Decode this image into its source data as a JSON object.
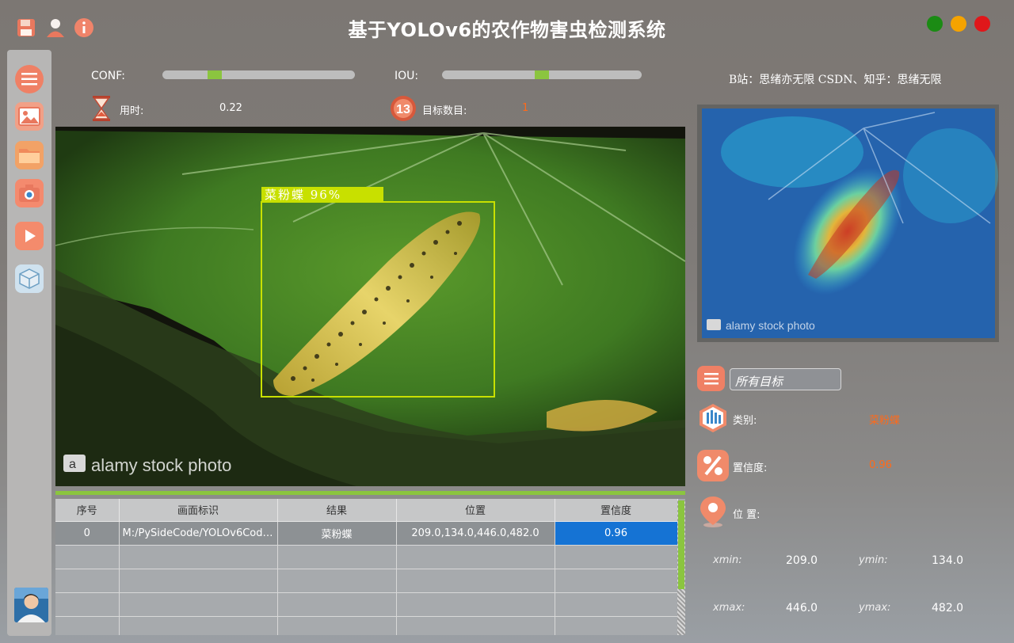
{
  "app": {
    "title": "基于YOLOv6的农作物害虫检测系统",
    "credit": "B站：思绪亦无限  CSDN、知乎：思绪无限",
    "window_buttons": {
      "green": "#1b8b14",
      "yellow": "#f5a300",
      "red": "#e0171a"
    },
    "toolbar_icons": [
      "save-icon",
      "user-icon",
      "info-icon"
    ]
  },
  "sidebar": {
    "items": [
      {
        "icon": "menu-icon"
      },
      {
        "icon": "image-icon"
      },
      {
        "icon": "folder-icon"
      },
      {
        "icon": "camera-icon"
      },
      {
        "icon": "video-icon"
      },
      {
        "icon": "model-cube-icon"
      }
    ]
  },
  "controls": {
    "conf_label": "CONF:",
    "conf_value": 0.3,
    "iou_label": "IOU:",
    "iou_value": 0.5,
    "time_label": "用时:",
    "time_value": "0.22",
    "count_label": "目标数目:",
    "count_value": "1"
  },
  "detection": {
    "label": "菜粉蝶 96%",
    "watermark": "alamy stock photo",
    "box_color": "#c8e000"
  },
  "table": {
    "headers": [
      "序号",
      "画面标识",
      "结果",
      "位置",
      "置信度"
    ],
    "rows": [
      [
        "0",
        "M:/PySideCode/YOLOv6Code/...",
        "菜粉蝶",
        "209.0,134.0,446.0,482.0",
        "0.96"
      ]
    ],
    "empty_rows": 4
  },
  "result_panel": {
    "heatmap_watermark": "alamy stock photo",
    "filter_placeholder": "所有目标",
    "class_label": "类别:",
    "class_value": "菜粉蝶",
    "conf_label": "置信度:",
    "conf_value": "0.96",
    "pos_label": "位 置:",
    "xmin_label": "xmin:",
    "xmin_value": "209.0",
    "ymin_label": "ymin:",
    "ymin_value": "134.0",
    "xmax_label": "xmax:",
    "xmax_value": "446.0",
    "ymax_label": "ymax:",
    "ymax_value": "482.0"
  }
}
